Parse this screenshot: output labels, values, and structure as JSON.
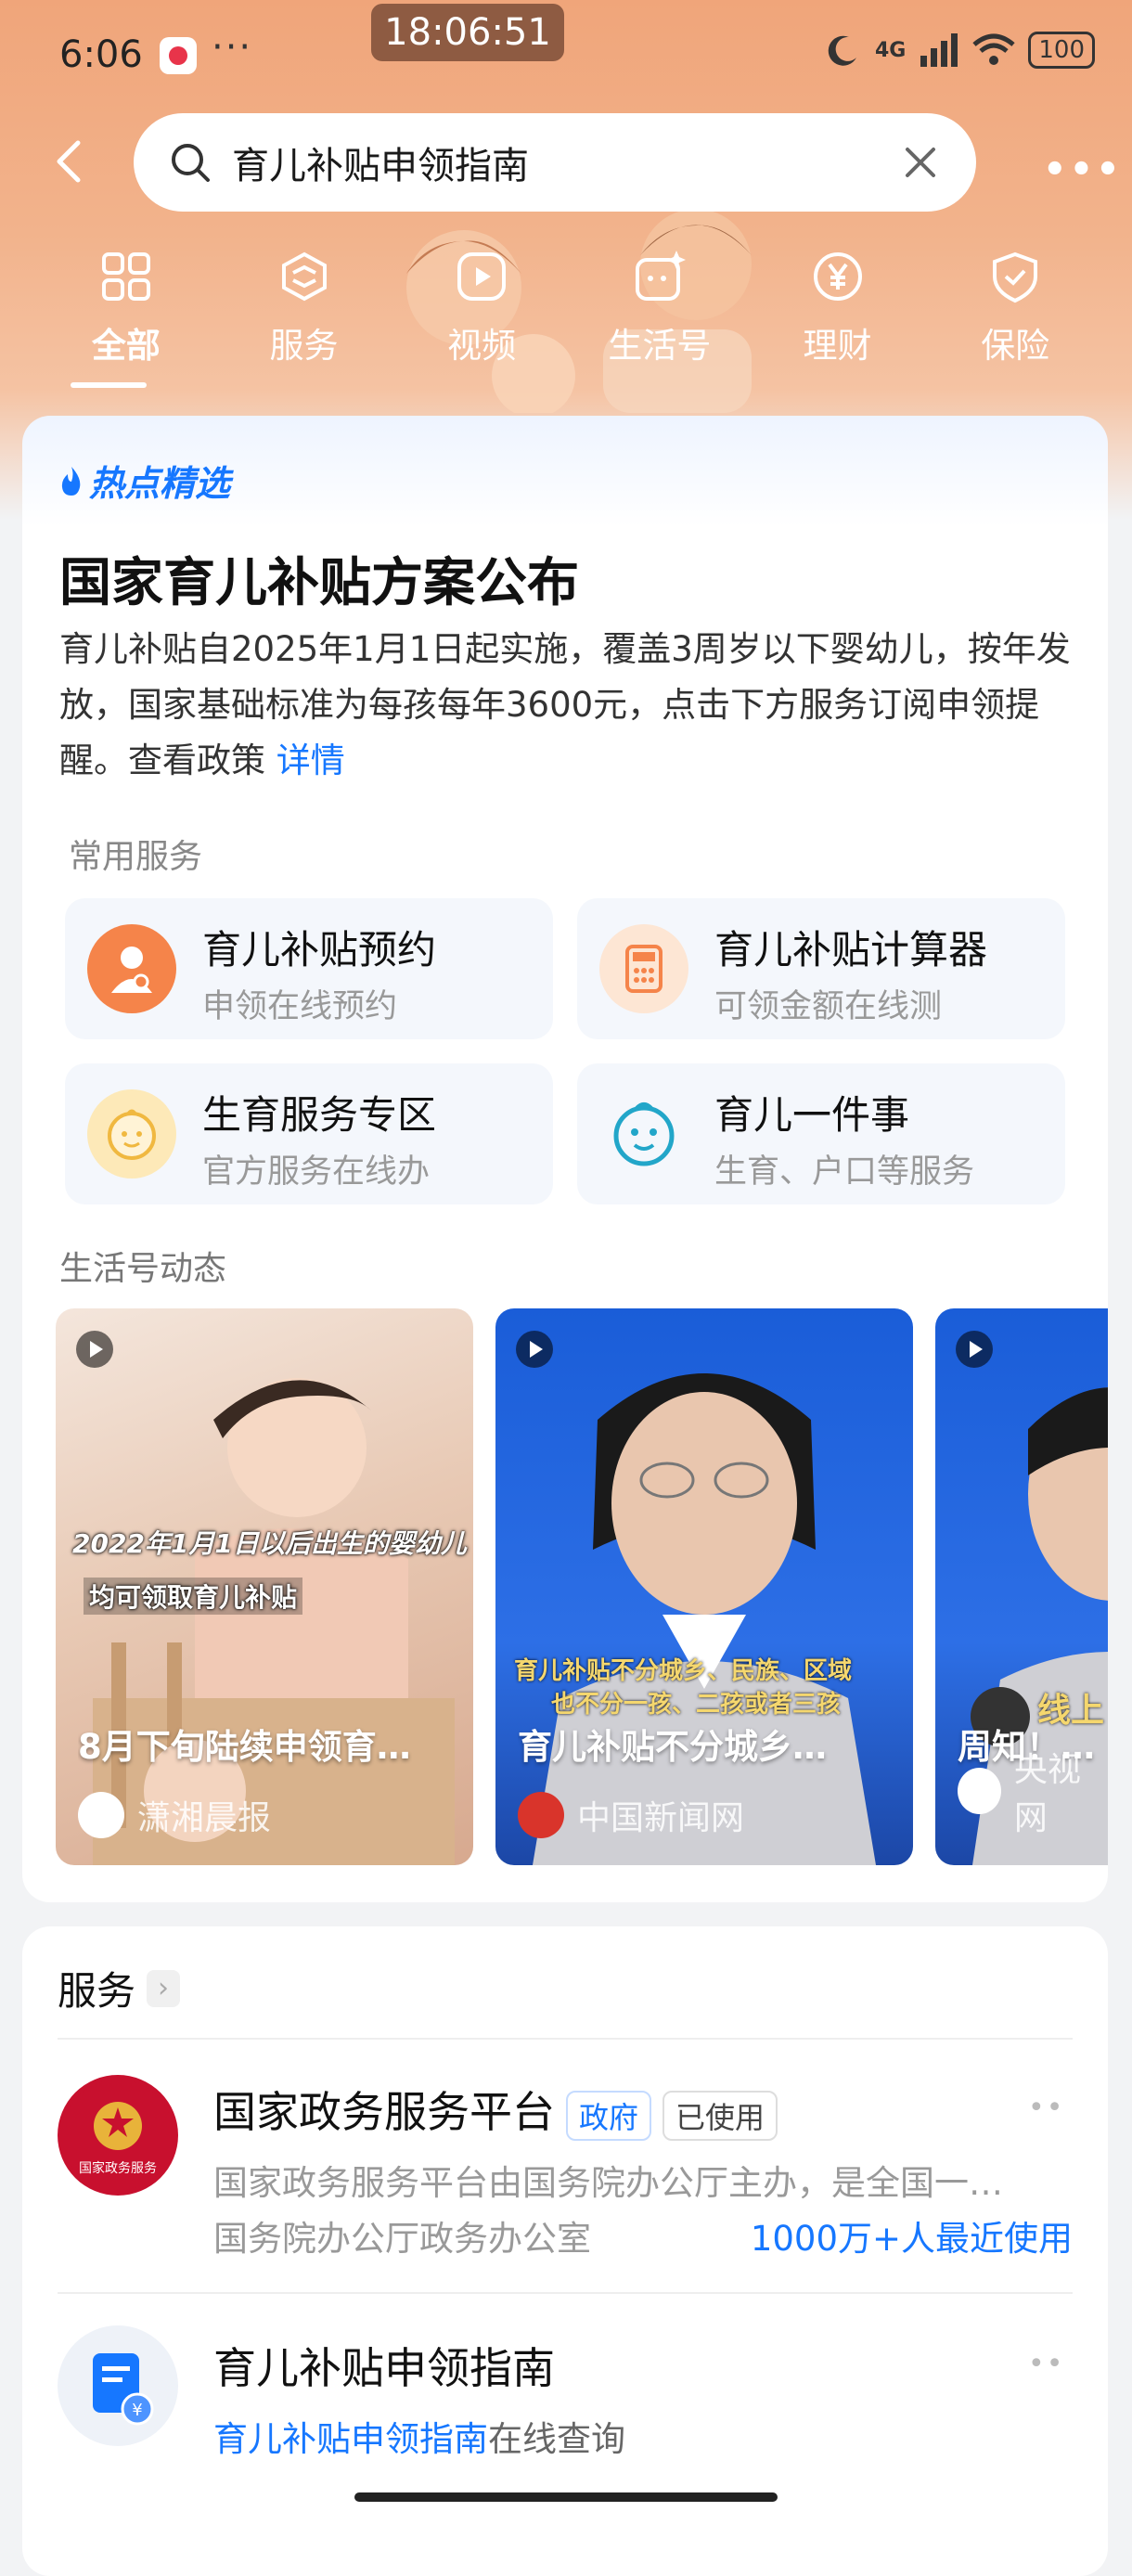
{
  "status_bar": {
    "time": "6:06",
    "clock_overlay": "18:06:51",
    "more": "···",
    "network": "4G",
    "battery": "100"
  },
  "search": {
    "value": "育儿补贴申领指南"
  },
  "tabs": [
    {
      "label": "全部",
      "icon": "grid-icon"
    },
    {
      "label": "服务",
      "icon": "cube-icon"
    },
    {
      "label": "视频",
      "icon": "play-icon"
    },
    {
      "label": "生活号",
      "icon": "sparkle-icon"
    },
    {
      "label": "理财",
      "icon": "yuan-icon"
    },
    {
      "label": "保险",
      "icon": "shield-icon"
    }
  ],
  "hot": {
    "tag": "热点精选",
    "title": "国家育儿补贴方案公布",
    "desc": "育儿补贴自2025年1月1日起实施，覆盖3周岁以下婴幼儿，按年发放，国家基础标准为每孩每年3600元，点击下方服务订阅申领提醒。查看政策",
    "link": "详情"
  },
  "common_services": {
    "label": "常用服务",
    "items": [
      {
        "title": "育儿补贴预约",
        "subtitle": "申领在线预约",
        "color": "#f5844a"
      },
      {
        "title": "育儿补贴计算器",
        "subtitle": "可领金额在线测",
        "color": "#f5844a"
      },
      {
        "title": "生育服务专区",
        "subtitle": "官方服务在线办",
        "color": "#f0b840"
      },
      {
        "title": "育儿一件事",
        "subtitle": "生育、户口等服务",
        "color": "#22a6c9"
      }
    ]
  },
  "feed": {
    "label": "生活号动态",
    "videos": [
      {
        "title": "8月下旬陆续申领育…",
        "source": "潇湘晨报",
        "caption1": "2022年1月1日以后出生的婴幼儿",
        "caption2": "均可领取育儿补贴"
      },
      {
        "title": "育儿补贴不分城乡…",
        "source": "中国新闻网",
        "caption1": "育儿补贴不分城乡、民族、区域",
        "caption2": "也不分一孩、二孩或者三孩"
      },
      {
        "title": "周知！线…",
        "source": "央视网",
        "caption1": "线上",
        "caption2": ""
      }
    ]
  },
  "services_section": {
    "label": "服务",
    "chevron": "›",
    "items": [
      {
        "title": "国家政务服务平台",
        "badges": [
          "政府",
          "已使用"
        ],
        "desc": "国家政务服务平台由国务院办公厅主办，是全国一…",
        "org": "国务院办公厅政务办公室",
        "usage": "1000万+人最近使用",
        "logo_text": "国家政务服务"
      },
      {
        "title": "育儿补贴申领指南",
        "desc_link": "育儿补贴申领指南",
        "desc_rest": "在线查询"
      }
    ]
  }
}
